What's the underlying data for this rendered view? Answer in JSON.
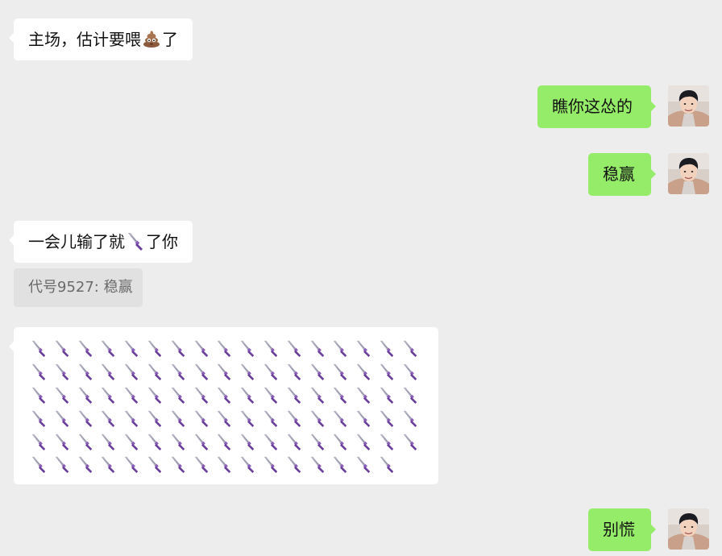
{
  "messages": [
    {
      "side": "in",
      "text_before": "主场，估计要喂",
      "emoji": "poop-icon",
      "text_after": "了"
    },
    {
      "side": "out",
      "text": "瞧你这怂的"
    },
    {
      "side": "out",
      "text": "稳赢"
    },
    {
      "side": "in",
      "text_before": "一会儿输了就",
      "emoji": "knife-icon",
      "text_after": "了你",
      "quote": "代号9527: 稳赢"
    },
    {
      "side": "in",
      "emoji_grid": {
        "icon": "knife-icon",
        "counts_per_row": [
          17,
          17,
          17,
          17,
          17,
          16
        ]
      }
    },
    {
      "side": "out",
      "text": "别慌"
    }
  ],
  "colors": {
    "background": "#ededed",
    "incoming_bubble": "#ffffff",
    "outgoing_bubble": "#95ec69",
    "quote_bg": "#e1e1e1",
    "quote_text": "#6a6a6a"
  }
}
